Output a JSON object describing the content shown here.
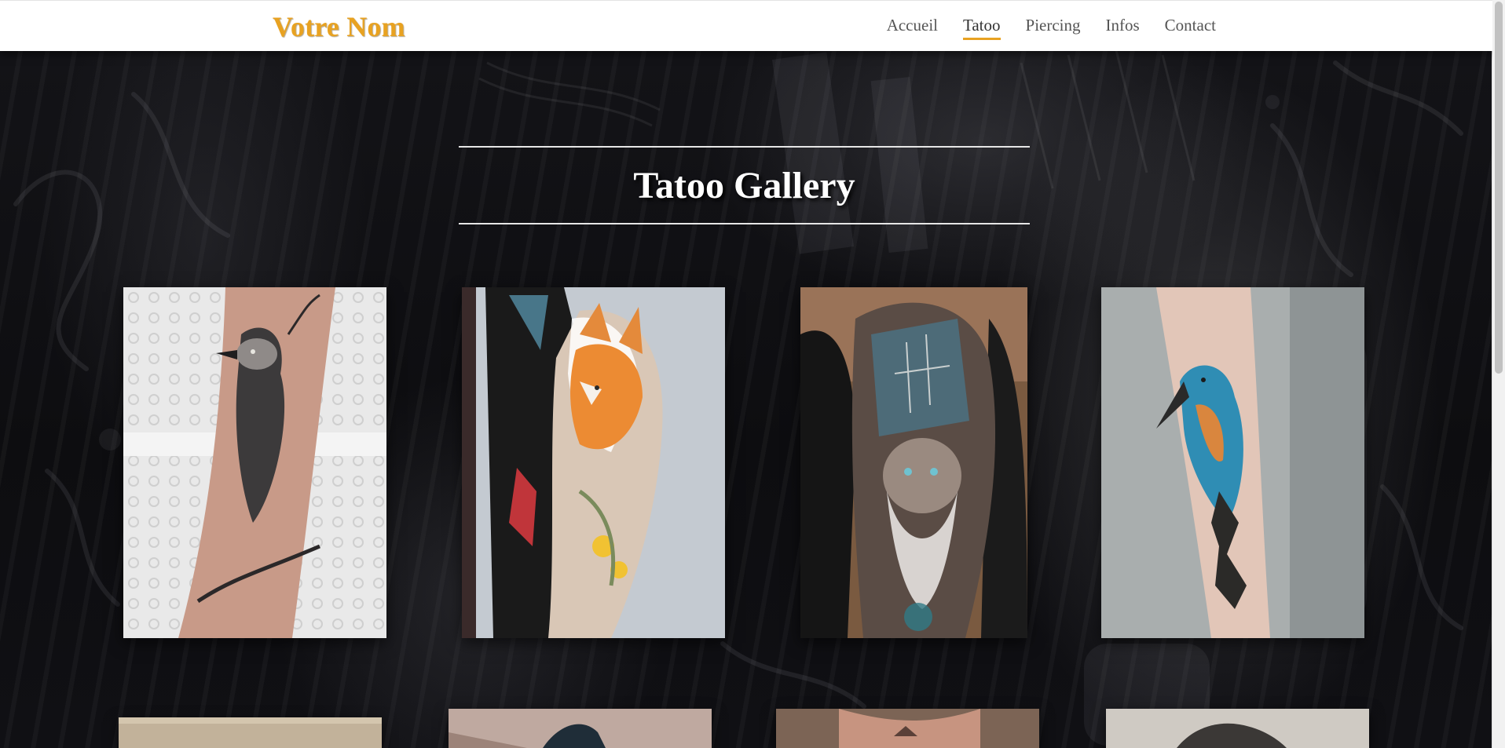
{
  "header": {
    "brand": "Votre Nom",
    "nav": [
      {
        "label": "Accueil",
        "active": false
      },
      {
        "label": "Tatoo",
        "active": true
      },
      {
        "label": "Piercing",
        "active": false
      },
      {
        "label": "Infos",
        "active": false
      },
      {
        "label": "Contact",
        "active": false
      }
    ]
  },
  "main": {
    "title": "Tatoo Gallery"
  },
  "colors": {
    "brand": "#e8a221",
    "header_bg": "#ffffff",
    "page_bg": "#0d0d10",
    "title": "#ffffff"
  },
  "gallery": {
    "items": [
      {
        "subject": "crow on branch, black and grey forearm tattoo"
      },
      {
        "subject": "fox with flowers, color half sleeve"
      },
      {
        "subject": "old sailor with ship, color shoulder tattoo"
      },
      {
        "subject": "kingfisher on driftwood, color forearm tattoo"
      },
      {
        "subject": "partially visible tattoo photo"
      },
      {
        "subject": "partially visible tattoo photo"
      },
      {
        "subject": "partially visible tattoo photo"
      },
      {
        "subject": "partially visible tattoo photo"
      }
    ]
  }
}
